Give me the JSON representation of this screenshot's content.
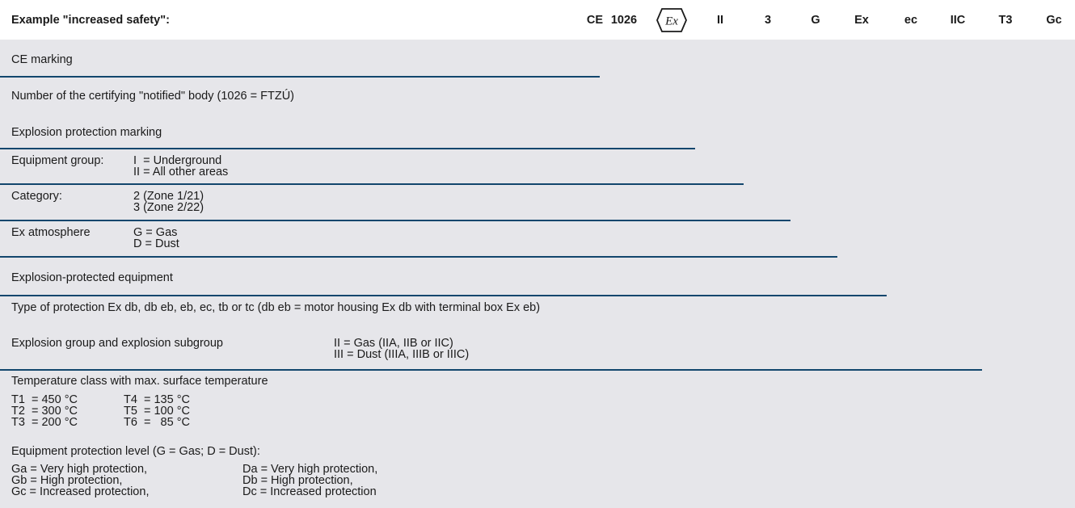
{
  "header": {
    "title": "Example \"increased safety\":",
    "marks": [
      "CE",
      "1026",
      "Ex",
      "II",
      "3",
      "G",
      "Ex",
      "ec",
      "IIC",
      "T3",
      "Gc"
    ]
  },
  "rows": {
    "ce": "CE marking",
    "notified": "Number of the certifying \"notified\" body (1026 = FTZÚ)",
    "explosion_marking": "Explosion protection marking",
    "equipment_group": {
      "label": "Equipment group:",
      "lines": [
        "I  = Underground",
        "II = All other areas"
      ]
    },
    "category": {
      "label": "Category:",
      "lines": [
        "2 (Zone 1/21)",
        "3 (Zone 2/22)"
      ]
    },
    "ex_atmosphere": {
      "label": "Ex atmosphere",
      "lines": [
        "G = Gas",
        "D = Dust"
      ]
    },
    "protected_equipment": "Explosion-protected equipment",
    "type_protection": "Type of protection Ex db, db eb, eb, ec, tb or tc (db eb = motor housing Ex db with terminal box Ex eb)",
    "explosion_group": {
      "label": "Explosion group and explosion subgroup",
      "lines": [
        "II = Gas (IIA, IIB or IIC)",
        "III = Dust (IIIA, IIIB or IIIC)"
      ]
    },
    "temperature": {
      "label": "Temperature class with max. surface temperature",
      "col1": [
        "T1  = 450 °C",
        "T2  = 300 °C",
        "T3  = 200 °C"
      ],
      "col2": [
        "T4  = 135 °C",
        "T5  = 100 °C",
        "T6  =   85 °C"
      ]
    },
    "epl": {
      "label": "Equipment protection level (G = Gas; D = Dust):",
      "col1": [
        "Ga = Very high protection,",
        "Gb = High protection,",
        "Gc = Increased protection,"
      ],
      "col2": [
        "Da = Very high protection,",
        "Db = High protection,",
        "Dc = Increased protection"
      ]
    }
  },
  "colors": {
    "band": "#e6e6ea",
    "rule": "#12466d"
  }
}
